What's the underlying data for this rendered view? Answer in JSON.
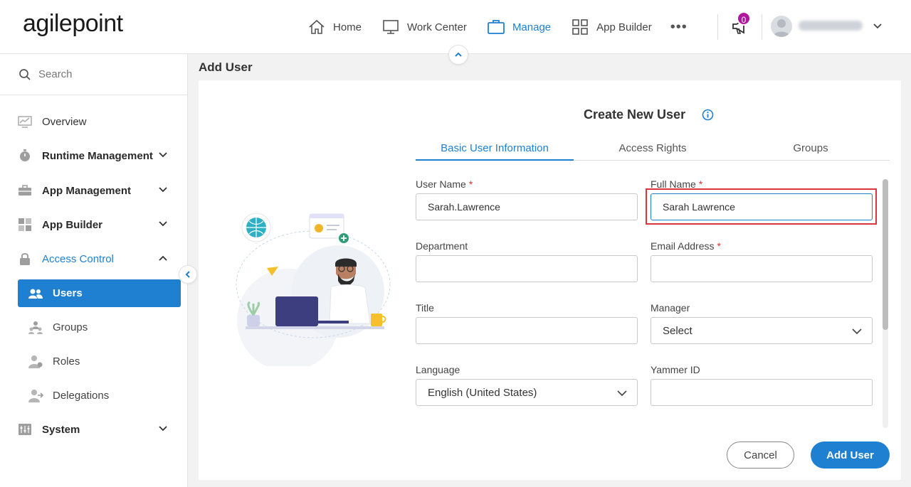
{
  "header": {
    "logo_text": "agilepoint",
    "nav": [
      {
        "label": "Home",
        "icon": "home-icon"
      },
      {
        "label": "Work Center",
        "icon": "monitor-icon"
      },
      {
        "label": "Manage",
        "icon": "briefcase-icon",
        "active": true
      },
      {
        "label": "App Builder",
        "icon": "grid-icon"
      }
    ],
    "more": "•••",
    "notification_count": "0"
  },
  "sidebar": {
    "search_placeholder": "Search",
    "items": [
      {
        "label": "Overview",
        "icon": "chart-icon"
      },
      {
        "label": "Runtime Management",
        "icon": "stopwatch-icon"
      },
      {
        "label": "App Management",
        "icon": "briefcase-icon"
      },
      {
        "label": "App Builder",
        "icon": "grid-icon"
      },
      {
        "label": "Access Control",
        "icon": "lock-icon"
      },
      {
        "label": "System",
        "icon": "sliders-icon"
      }
    ],
    "sub_items": [
      {
        "label": "Users",
        "icon": "users-icon",
        "selected": true
      },
      {
        "label": "Groups",
        "icon": "groups-icon"
      },
      {
        "label": "Roles",
        "icon": "roles-icon"
      },
      {
        "label": "Delegations",
        "icon": "delegations-icon"
      }
    ]
  },
  "main": {
    "page_title": "Add User",
    "card_title": "Create New User",
    "tabs": [
      "Basic User Information",
      "Access Rights",
      "Groups"
    ],
    "fields": {
      "user_name": {
        "label": "User Name",
        "value": "Sarah.Lawrence",
        "required": "*"
      },
      "full_name": {
        "label": "Full Name",
        "value": "Sarah Lawrence",
        "required": "*"
      },
      "department": {
        "label": "Department",
        "value": ""
      },
      "email": {
        "label": "Email Address",
        "value": "",
        "required": "*"
      },
      "title": {
        "label": "Title",
        "value": ""
      },
      "manager": {
        "label": "Manager",
        "value": "Select"
      },
      "language": {
        "label": "Language",
        "value": "English (United States)"
      },
      "yammer": {
        "label": "Yammer ID",
        "value": ""
      }
    },
    "buttons": {
      "cancel": "Cancel",
      "add": "Add User"
    }
  },
  "colors": {
    "accent": "#1f7fd1",
    "highlight": "#d9363e",
    "badge": "#b2169b"
  }
}
